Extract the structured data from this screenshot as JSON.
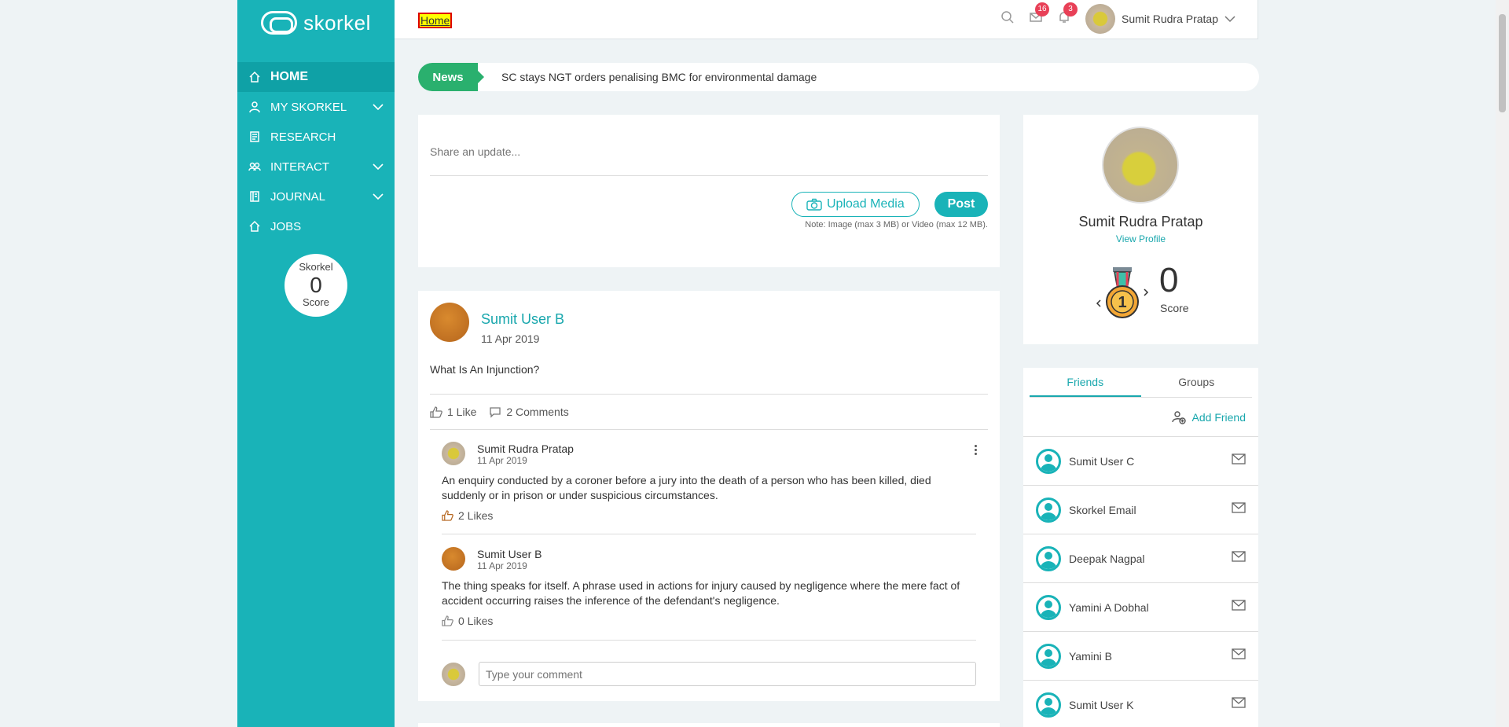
{
  "app": {
    "logo_text": "skorkel"
  },
  "sidebar": {
    "items": [
      {
        "label": "HOME",
        "active": true,
        "icon": "home-icon",
        "expandable": false
      },
      {
        "label": "MY SKORKEL",
        "active": false,
        "icon": "user-icon",
        "expandable": true
      },
      {
        "label": "RESEARCH",
        "active": false,
        "icon": "research-icon",
        "expandable": false
      },
      {
        "label": "INTERACT",
        "active": false,
        "icon": "people-icon",
        "expandable": true
      },
      {
        "label": "JOURNAL",
        "active": false,
        "icon": "journal-icon",
        "expandable": true
      },
      {
        "label": "JOBS",
        "active": false,
        "icon": "home-icon",
        "expandable": false
      }
    ],
    "score": {
      "top": "Skorkel",
      "value": "0",
      "bottom": "Score"
    }
  },
  "header": {
    "breadcrumb": "Home",
    "messages_count": "16",
    "notifications_count": "3",
    "user_name": "Sumit Rudra Pratap"
  },
  "news": {
    "tag": "News",
    "headline": "SC stays NGT orders penalising BMC for environmental damage"
  },
  "share": {
    "placeholder": "Share an update...",
    "upload_label": "Upload Media",
    "post_label": "Post",
    "note": "Note: Image (max 3 MB) or Video (max 12 MB)."
  },
  "post": {
    "author": "Sumit User B",
    "date": "11 Apr 2019",
    "text": "What Is An Injunction?",
    "likes": "1 Like",
    "comments": "2 Comments",
    "comment_list": [
      {
        "author": "Sumit Rudra Pratap",
        "date": "11 Apr 2019",
        "text": "An enquiry conducted by a coroner before a jury into the death of a person who has been killed, died suddenly or in prison or under suspicious circumstances.",
        "likes": "2 Likes"
      },
      {
        "author": "Sumit User B",
        "date": "11 Apr 2019",
        "text": "The thing speaks for itself. A phrase used in actions for injury caused by negligence where the mere fact of accident occurring raises the inference of the defendant's negligence.",
        "likes": "0 Likes"
      }
    ],
    "comment_placeholder": "Type your comment"
  },
  "profile": {
    "name": "Sumit Rudra Pratap",
    "view_profile": "View Profile",
    "score": "0",
    "score_label": "Score",
    "medal_number": "1"
  },
  "friends_panel": {
    "tabs": [
      "Friends",
      "Groups"
    ],
    "add_friend": "Add Friend",
    "friends": [
      "Sumit User C",
      "Skorkel Email",
      "Deepak Nagpal",
      "Yamini A Dobhal",
      "Yamini B",
      "Sumit User K"
    ]
  },
  "colors": {
    "accent": "#19b3b8",
    "news_green": "#2ab06e",
    "badge_red": "#e84057"
  }
}
